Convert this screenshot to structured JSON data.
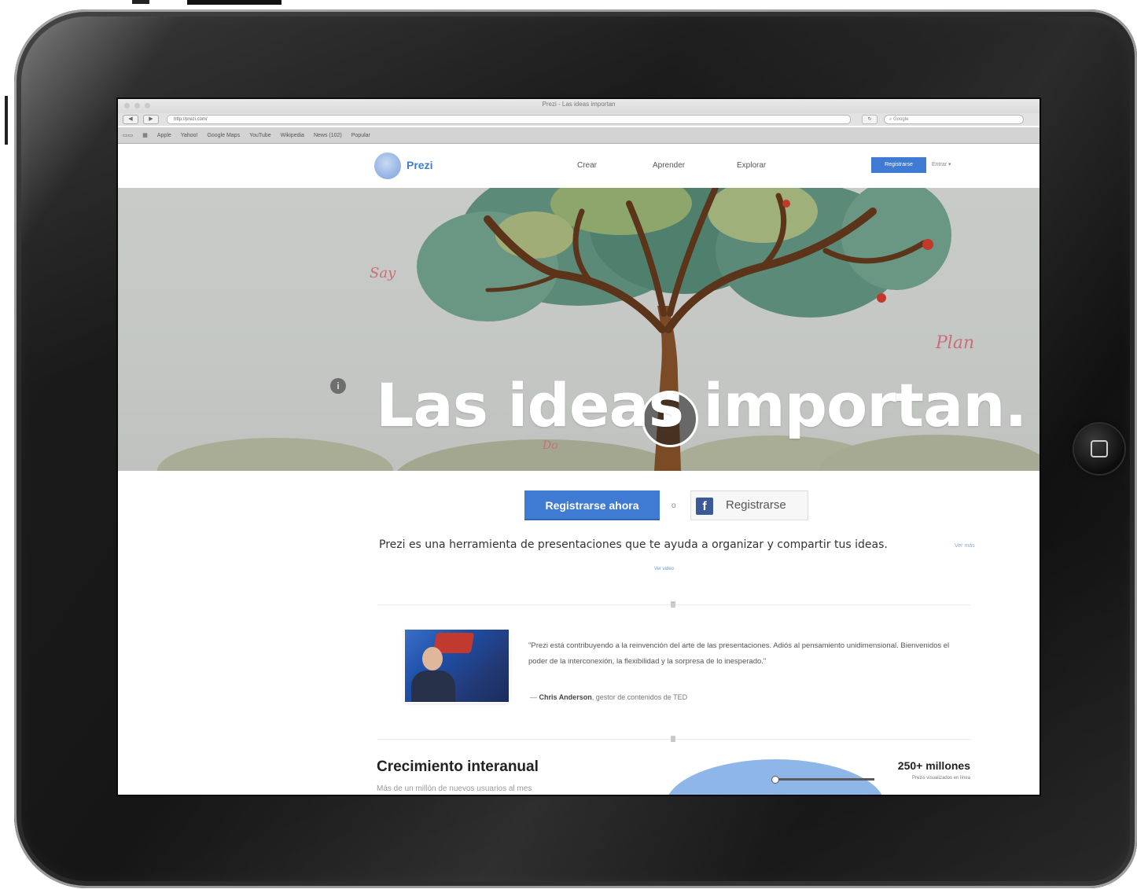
{
  "browser": {
    "window_title": "Prezi - Las ideas importan",
    "url": "http://prezi.com/",
    "search_placeholder": "Google",
    "back_label": "◀",
    "forward_label": "▶",
    "bookmarks": [
      "Apple",
      "Yahoo!",
      "Google Maps",
      "YouTube",
      "Wikipedia",
      "News (102)",
      "Popular"
    ]
  },
  "header": {
    "logo": "Prezi",
    "nav": [
      "Crear",
      "Aprender",
      "Explorar"
    ],
    "signup_label": "Registrarse",
    "login_label": "Entrar"
  },
  "hero": {
    "title": "Las ideas importan.",
    "info_label": "i",
    "notes": [
      "Say",
      "Plan",
      "Do"
    ]
  },
  "cta": {
    "primary_label": "Registrarse ahora",
    "or_label": "o",
    "facebook_label": "Registrarse",
    "facebook_icon": "f"
  },
  "tagline": {
    "text": "Prezi es una herramienta de presentaciones que te ayuda a organizar y compartir tus ideas.",
    "more": "Ver más",
    "see_more": "Ver video"
  },
  "testimonial": {
    "quote": "\"Prezi está contribuyendo a la reinvención del arte de las presentaciones. Adiós al pensamiento unidimensional. Bienvenidos el poder de la interconexión, la flexibilidad y la sorpresa de lo inesperado.\"",
    "author_prefix": "— ",
    "author_name": "Chris Anderson",
    "author_role": ", gestor de contenidos de TED"
  },
  "growth": {
    "title": "Crecimiento interanual",
    "subtitle": "Más de un millón de nuevos usuarios al mes",
    "stat_value": "250+ millones",
    "stat_label": "Prezis visualizados en línea"
  },
  "colors": {
    "accent": "#3f7ad3",
    "facebook": "#3b5998",
    "device": "#161616"
  }
}
